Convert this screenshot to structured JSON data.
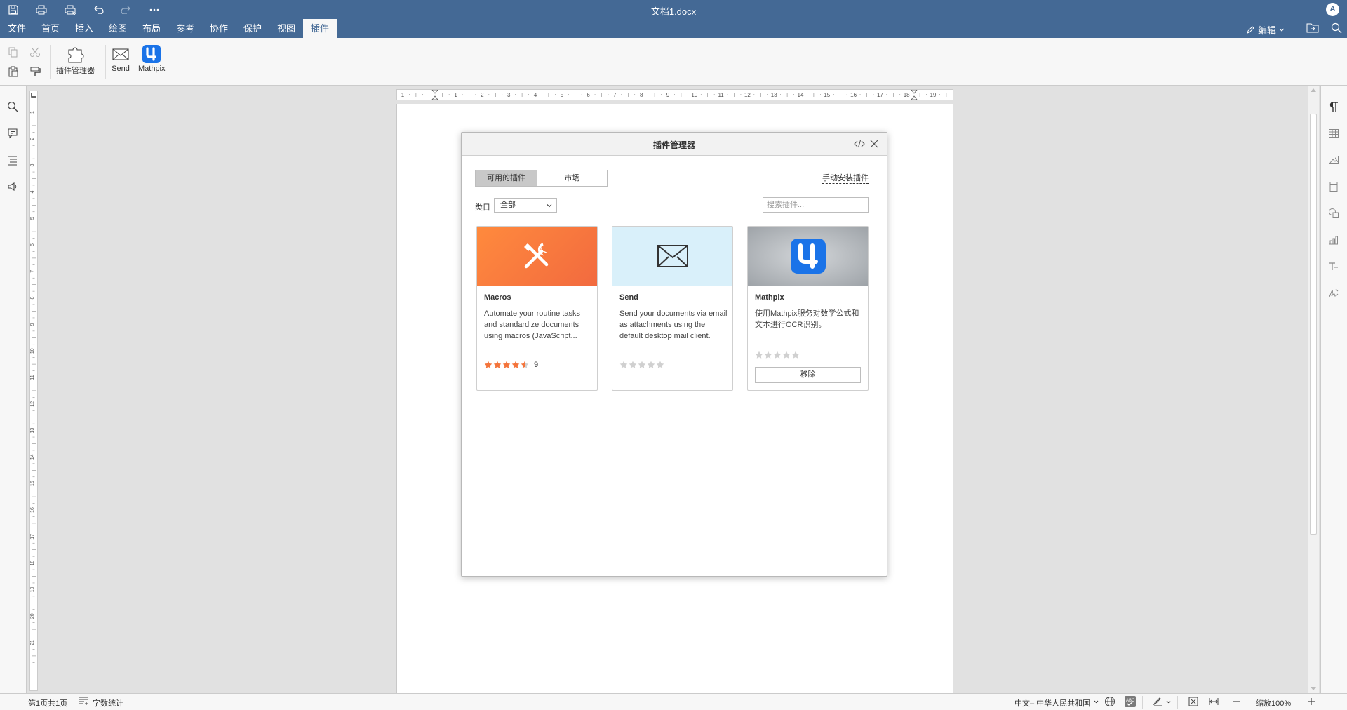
{
  "window": {
    "title": "文档1.docx",
    "user_initial": "A"
  },
  "menu": {
    "tabs": [
      "文件",
      "首页",
      "插入",
      "绘图",
      "布局",
      "参考",
      "协作",
      "保护",
      "视图",
      "插件"
    ],
    "active_tab": "插件",
    "edit_mode": "编辑"
  },
  "toolbar": {
    "plugin_manager_label": "插件管理器",
    "send_label": "Send",
    "mathpix_label": "Mathpix"
  },
  "ruler": {
    "h_labels": [
      "1",
      "·",
      "1",
      "2",
      "3",
      "4",
      "5",
      "6",
      "7",
      "8",
      "9",
      "10",
      "11",
      "12",
      "13",
      "14",
      "15",
      "16",
      "17",
      "18",
      "19"
    ],
    "v_labels": [
      "1",
      "2",
      "3",
      "4",
      "5",
      "6",
      "7",
      "8",
      "9",
      "10",
      "11",
      "12",
      "13",
      "14",
      "15",
      "16",
      "17",
      "18",
      "19",
      "20",
      "21"
    ]
  },
  "dialog": {
    "title": "插件管理器",
    "tab_available": "可用的插件",
    "tab_market": "市场",
    "manual_install": "手动安装插件",
    "category_label": "类目",
    "category_value": "全部",
    "search_placeholder": "搜索插件...",
    "plugins": [
      {
        "name": "Macros",
        "description": "Automate your routine tasks and standardize documents using macros (JavaScript...",
        "rating": 4.5,
        "rating_count": "9",
        "banner_color": "#f4743b"
      },
      {
        "name": "Send",
        "description": "Send your documents via email as attachments using the default desktop mail client.",
        "rating": 0,
        "rating_count": "",
        "banner_color": "#d9f0fa"
      },
      {
        "name": "Mathpix",
        "description": "使用Mathpix服务对数学公式和文本进行OCR识别。",
        "rating": 0,
        "rating_count": "",
        "banner_color": "#a4a9ae",
        "action_label": "移除"
      }
    ]
  },
  "status": {
    "page_info": "第1页共1页",
    "word_count": "字数统计",
    "language": "中文– 中华人民共和国",
    "zoom": "缩放100%"
  },
  "colors": {
    "accent": "#446995",
    "macro_orange": "#f4743b",
    "star_filled": "#f4743b",
    "star_empty": "#d0d0d0"
  }
}
